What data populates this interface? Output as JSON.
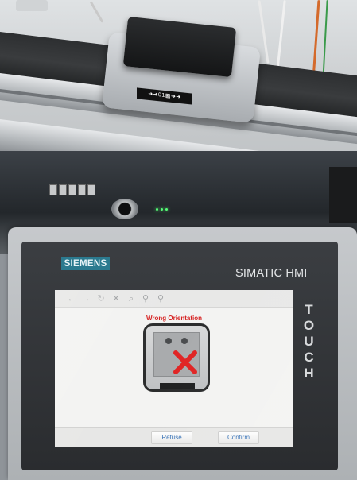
{
  "device": {
    "brand": "SIEMENS",
    "model": "SIMATIC HMI",
    "touch_label": "TOUCH"
  },
  "carrier": {
    "label": "➜➜01▩➜➜"
  },
  "screen": {
    "toolbar_icons": [
      "arrow-left-icon",
      "arrow-right-icon",
      "refresh-icon",
      "close-icon",
      "zoom-icon",
      "zoom-in-icon",
      "zoom-out-icon"
    ],
    "message": "Wrong Orientation",
    "buttons": {
      "refuse": "Refuse",
      "confirm": "Confirm"
    }
  },
  "colors": {
    "brand_accent": "#2b7a8f",
    "error_red": "#d62020",
    "button_text": "#3a74b8"
  }
}
